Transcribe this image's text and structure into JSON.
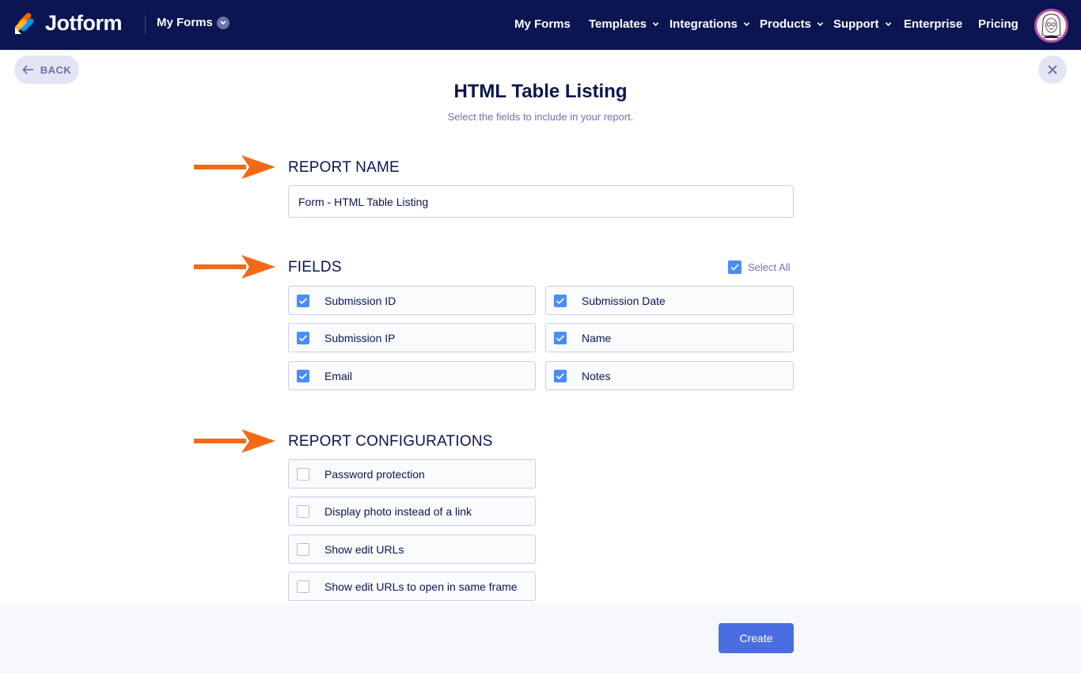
{
  "header": {
    "logo_text": "Jotform",
    "myforms_dropdown": "My Forms",
    "nav": [
      {
        "label": "My Forms"
      },
      {
        "label": "Templates"
      },
      {
        "label": "Integrations"
      },
      {
        "label": "Products"
      },
      {
        "label": "Support"
      },
      {
        "label": "Enterprise"
      },
      {
        "label": "Pricing"
      }
    ],
    "bg_color": "#0a1551"
  },
  "back_label": "BACK",
  "page": {
    "title": "HTML Table Listing",
    "subtitle": "Select the fields to include in your report."
  },
  "report_name": {
    "label": "REPORT NAME",
    "value": "Form - HTML Table Listing"
  },
  "fields": {
    "label": "FIELDS",
    "select_all": {
      "label": "Select All",
      "checked": true
    },
    "items": [
      {
        "label": "Submission ID",
        "checked": true
      },
      {
        "label": "Submission Date",
        "checked": true
      },
      {
        "label": "Submission IP",
        "checked": true
      },
      {
        "label": "Name",
        "checked": true
      },
      {
        "label": "Email",
        "checked": true
      },
      {
        "label": "Notes",
        "checked": true
      }
    ]
  },
  "configurations": {
    "label": "REPORT CONFIGURATIONS",
    "items": [
      {
        "label": "Password protection",
        "checked": false
      },
      {
        "label": "Display photo instead of a link",
        "checked": false
      },
      {
        "label": "Show edit URLs",
        "checked": false
      },
      {
        "label": "Show edit URLs to open in same frame",
        "checked": false
      }
    ]
  },
  "create_label": "Create",
  "colors": {
    "accent": "#4a6ee0",
    "checkbox": "#4a8df8",
    "arrow": "#f26a13",
    "text_dark": "#0a1551"
  },
  "icons": [
    "back-arrow-icon",
    "close-icon",
    "chevron-down-icon",
    "check-icon",
    "orange-arrow-icon"
  ]
}
